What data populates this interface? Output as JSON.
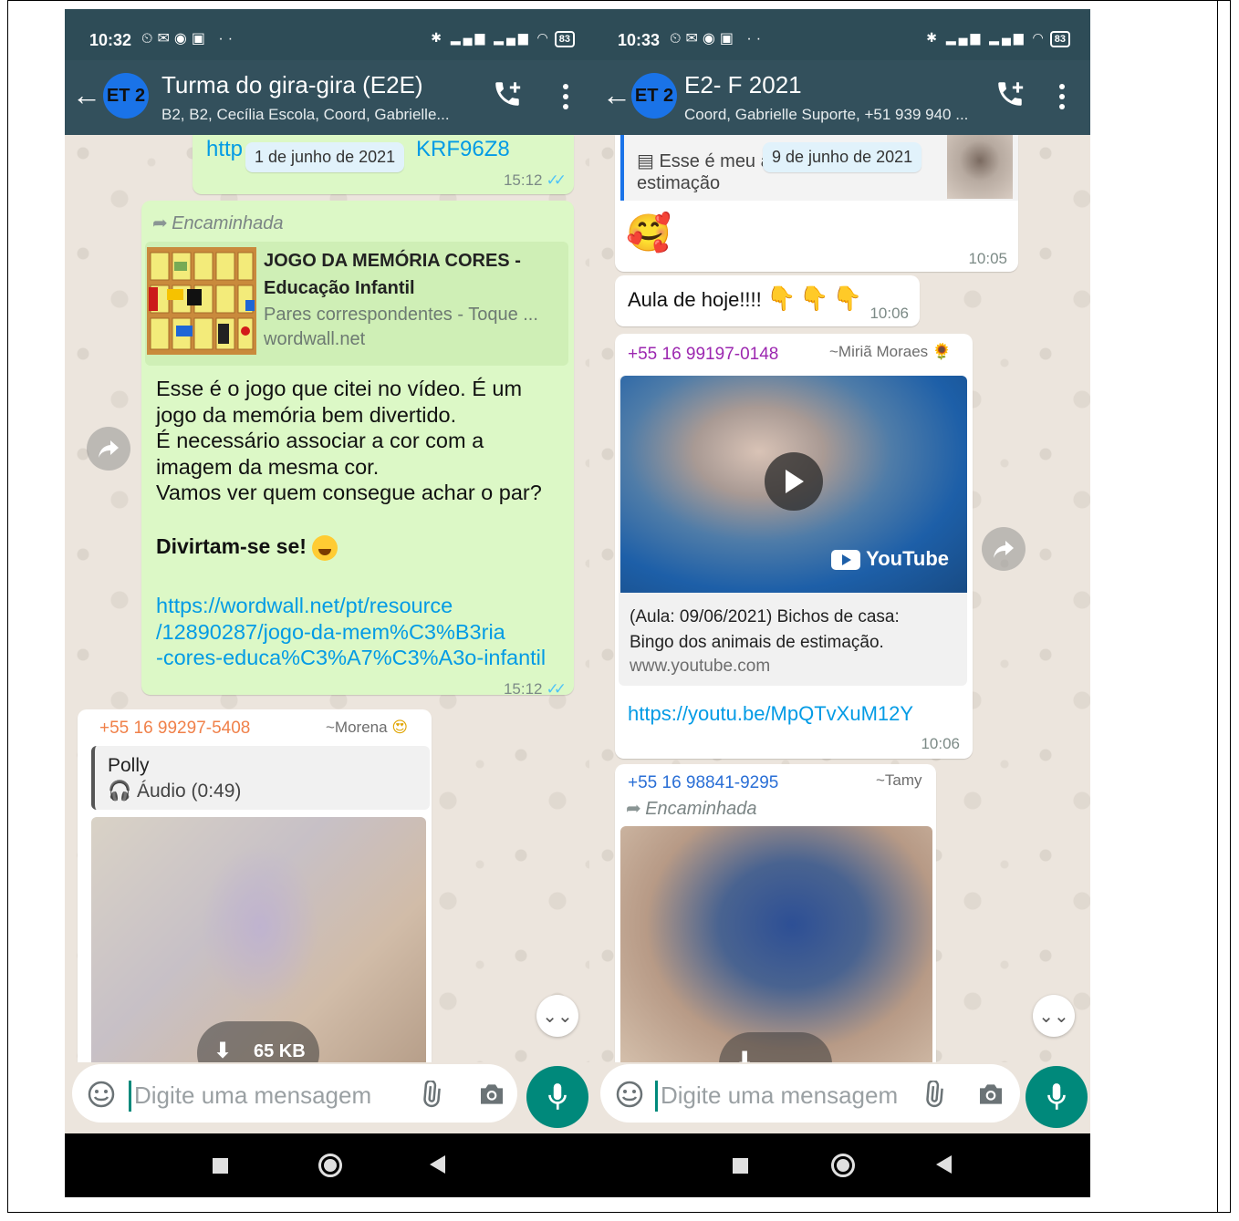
{
  "left": {
    "status_time": "10:32",
    "battery": "83",
    "avatar": "ET 2",
    "title": "Turma do  gira-gira (E2E)",
    "subtitle": "B2, B2, Cecília Escola, Coord, Gabrielle...",
    "date_chip": "1 de junho de 2021",
    "msg1": {
      "link_start": "http",
      "link_end": "KRF96Z8",
      "time": "15:12"
    },
    "msg2": {
      "forwarded": "Encaminhada",
      "card_title": "JOGO DA MEMÓRIA CORES -",
      "card_title2": "Educação Infantil",
      "card_desc": "Pares correspondentes - Toque ...",
      "card_domain": "wordwall.net",
      "body_lines": [
        "Esse é o jogo que citei no vídeo. É  um",
        "jogo da memória bem divertido.",
        "É necessário associar a cor com a",
        "imagem da mesma cor.",
        "Vamos ver quem consegue achar o par?"
      ],
      "bold_line": "Divirtam-se se!",
      "link_lines": [
        "https://wordwall.net/pt/resource",
        "/12890287/jogo-da-mem%C3%B3ria",
        "-cores-educa%C3%A7%C3%A3o-infantil"
      ],
      "time": "15:12"
    },
    "msg3": {
      "sender": "+55 16 99297-5408",
      "alias": "~Morena",
      "quote_name": "Polly",
      "quote_audio": "Áudio (0:49)",
      "download_size": "65 KB"
    },
    "input_placeholder": "Digite uma mensagem"
  },
  "right": {
    "status_time": "10:33",
    "battery": "83",
    "avatar": "ET 2",
    "title": "E2- F 2021",
    "subtitle": "Coord, Gabrielle Suporte, +51 939 940 ...",
    "date_chip": "9 de junho de 2021",
    "msg1": {
      "quote_line1": "Esse é meu ar",
      "quote_line2": "estimação",
      "time": "10:05"
    },
    "msg2": {
      "text": "Aula de hoje!!!!",
      "time": "10:06"
    },
    "msg3": {
      "sender": "+55 16 99197-0148",
      "alias": "~Miriã Moraes",
      "yt_label": "YouTube",
      "card_title": "(Aula: 09/06/2021) Bichos de casa:",
      "card_title2": "Bingo dos animais de estimação.",
      "card_domain": "www.youtube.com",
      "link": "https://youtu.be/MpQTvXuM12Y",
      "time": "10:06"
    },
    "msg4": {
      "sender": "+55 16 98841-9295",
      "alias": "~Tamy",
      "forwarded": "Encaminhada"
    },
    "input_placeholder": "Digite uma mensagem"
  },
  "colors": {
    "header": "#33505c",
    "accent": "#00897b",
    "outgoing_bubble": "#dcf8c6",
    "link": "#039be5"
  }
}
